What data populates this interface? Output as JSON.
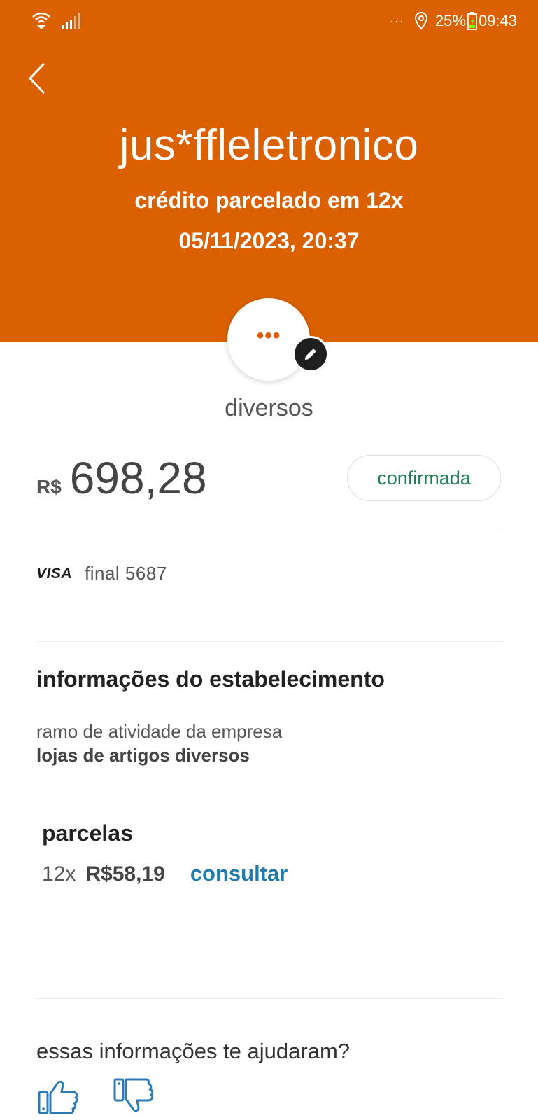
{
  "status_bar": {
    "dots": "···",
    "battery": "25%",
    "time": "09:43"
  },
  "header": {
    "merchant": "jus*ffleletronico",
    "transaction_type": "crédito parcelado em 12x",
    "datetime": "05/11/2023, 20:37"
  },
  "category": {
    "icon_glyph": "•••",
    "name": "diversos"
  },
  "amount": {
    "currency": "R$",
    "value": "698,28",
    "status": "confirmada"
  },
  "card": {
    "brand": "VISA",
    "final": "final 5687"
  },
  "merchant_info": {
    "title": "informações do estabelecimento",
    "label": "ramo de atividade da empresa",
    "value": "lojas de artigos diversos"
  },
  "installments": {
    "title": "parcelas",
    "count": "12x",
    "value": "R$58,19",
    "link": "consultar"
  },
  "feedback": {
    "question": "essas informações te ajudaram?"
  },
  "colors": {
    "header_bg": "#DA6000",
    "status_green": "#1D7B54",
    "link_blue": "#1F7CAE",
    "thumb_blue": "#2C7BB6"
  }
}
